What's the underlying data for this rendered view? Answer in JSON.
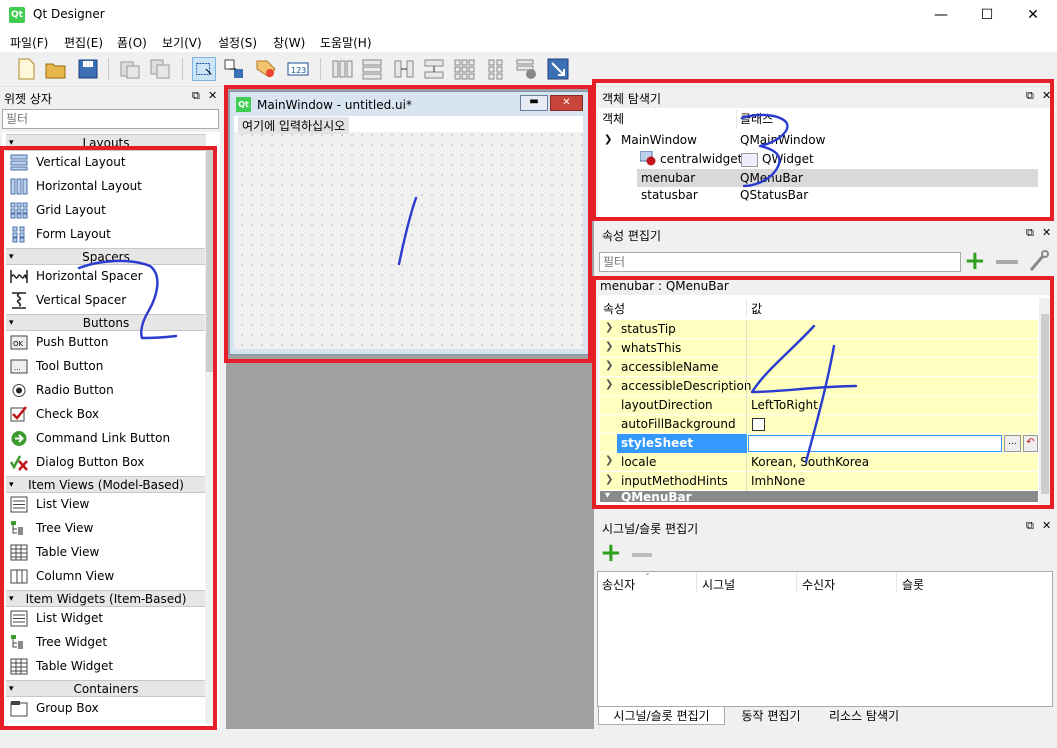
{
  "window": {
    "title": "Qt Designer",
    "logo": "Qt",
    "minimize": "—",
    "maximize": "☐",
    "close": "✕"
  },
  "menu": [
    "파일(F)",
    "편집(E)",
    "폼(O)",
    "보기(V)",
    "설정(S)",
    "창(W)",
    "도움말(H)"
  ],
  "toolbar_icons": [
    "new-file-icon",
    "open-folder-icon",
    "save-icon",
    "cut-icon",
    "copy-icon",
    "edit-widgets-icon",
    "edit-signals-icon",
    "edit-buddies-icon",
    "edit-tab-order-icon",
    "layout-horizontal-icon",
    "layout-vertical-icon",
    "layout-h-splitter-icon",
    "layout-v-splitter-icon",
    "layout-grid-icon",
    "layout-form-icon",
    "break-layout-icon",
    "adjust-size-icon"
  ],
  "widget_box": {
    "title": "위젯 상자",
    "filter_placeholder": "필터",
    "categories": [
      {
        "name": "Layouts",
        "items": [
          "Vertical Layout",
          "Horizontal Layout",
          "Grid Layout",
          "Form Layout"
        ]
      },
      {
        "name": "Spacers",
        "items": [
          "Horizontal Spacer",
          "Vertical Spacer"
        ]
      },
      {
        "name": "Buttons",
        "items": [
          "Push Button",
          "Tool Button",
          "Radio Button",
          "Check Box",
          "Command Link Button",
          "Dialog Button Box"
        ]
      },
      {
        "name": "Item Views (Model-Based)",
        "items": [
          "List View",
          "Tree View",
          "Table View",
          "Column View"
        ]
      },
      {
        "name": "Item Widgets (Item-Based)",
        "items": [
          "List Widget",
          "Tree Widget",
          "Table Widget"
        ]
      },
      {
        "name": "Containers",
        "items": [
          "Group Box"
        ]
      }
    ]
  },
  "form": {
    "title": "MainWindow - untitled.ui*",
    "menu_placeholder": "여기에 입력하십시오"
  },
  "object_inspector": {
    "title": "객체 탐색기",
    "col_object": "객체",
    "col_class": "클래스",
    "rows": [
      {
        "object": "MainWindow",
        "class": "QMainWindow"
      },
      {
        "object": "centralwidget",
        "class": "QWidget"
      },
      {
        "object": "menubar",
        "class": "QMenuBar"
      },
      {
        "object": "statusbar",
        "class": "QStatusBar"
      }
    ]
  },
  "property_editor": {
    "title": "속성 편집기",
    "filter_placeholder": "필터",
    "context": "menubar : QMenuBar",
    "col_property": "속성",
    "col_value": "값",
    "rows": [
      {
        "name": "statusTip",
        "value": ""
      },
      {
        "name": "whatsThis",
        "value": ""
      },
      {
        "name": "accessibleName",
        "value": ""
      },
      {
        "name": "accessibleDescription",
        "value": ""
      },
      {
        "name": "layoutDirection",
        "value": "LeftToRight"
      },
      {
        "name": "autoFillBackground",
        "value": ""
      },
      {
        "name": "styleSheet",
        "value": ""
      },
      {
        "name": "locale",
        "value": "Korean, SouthKorea"
      },
      {
        "name": "inputMethodHints",
        "value": "ImhNone"
      },
      {
        "name": "QMenuBar",
        "value": ""
      }
    ],
    "edit_button": "...",
    "reset_button": "↶"
  },
  "signal_slot_editor": {
    "title": "시그널/슬롯 편집기",
    "columns": [
      "송신자",
      "시그널",
      "수신자",
      "슬롯"
    ]
  },
  "bottom_tabs": [
    "시그널/슬롯 편집기",
    "동작 편집기",
    "리소스 탐색기"
  ],
  "annotations": [
    "1",
    "2",
    "3",
    "4"
  ],
  "colors": {
    "highlight": "#e61e28",
    "annotation_ink": "#2a3bd1",
    "property_yellow": "#ffffbf",
    "selected": "#3399ff"
  }
}
